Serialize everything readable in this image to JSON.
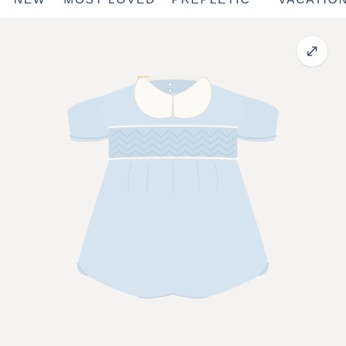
{
  "nav": {
    "items": [
      "NEW",
      "MOST LOVED",
      "PREPLETIC",
      "VACATION"
    ]
  },
  "gallery": {
    "expand_icon": "expand-arrows-icon",
    "product_image": "light-blue-smocked-bubble-romper-with-white-collar"
  },
  "colors": {
    "nav_text": "#2f3f66",
    "panel_bg": "#f4f3f1",
    "romper_blue": "#d6e4ef",
    "collar_white": "#fbfaf6"
  }
}
